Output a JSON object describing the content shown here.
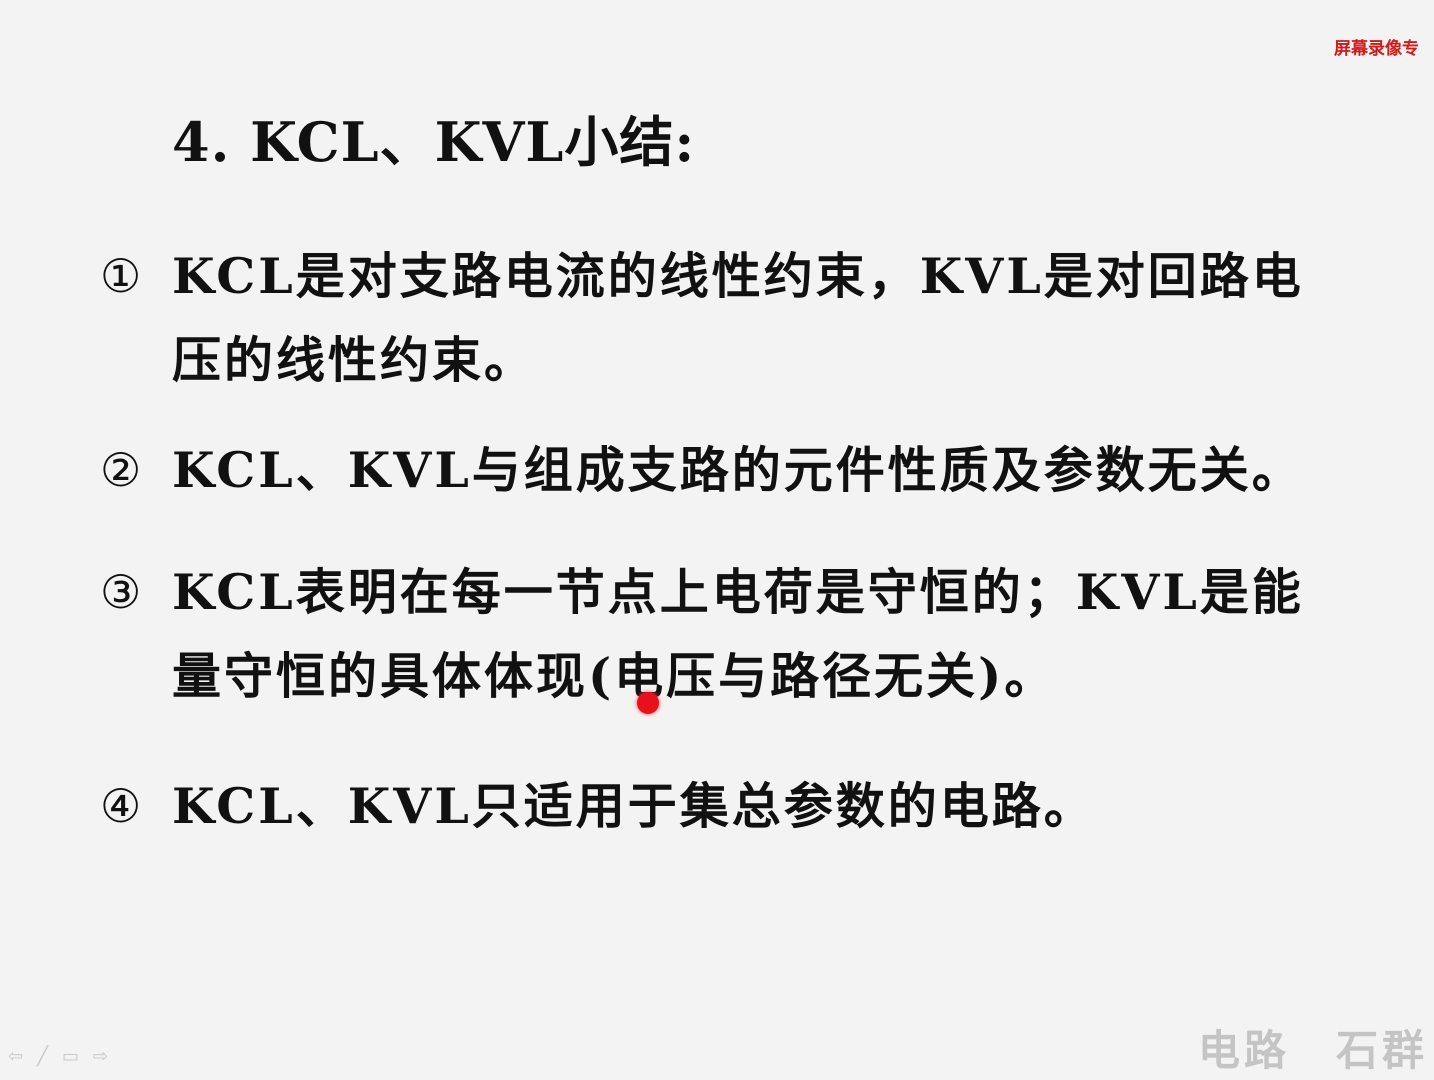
{
  "watermark": "屏幕录像专",
  "title": "4.  KCL、KVL小结:",
  "items": [
    {
      "num": "①",
      "text": "KCL是对支路电流的线性约束，KVL是对回路电压的线性约束。"
    },
    {
      "num": "②",
      "text": "KCL、KVL与组成支路的元件性质及参数无关。"
    },
    {
      "num": "③",
      "text": "KCL表明在每一节点上电荷是守恒的；KVL是能量守恒的具体体现(电压与路径无关)。"
    },
    {
      "num": "④",
      "text": "KCL、KVL只适用于集总参数的电路。"
    }
  ],
  "footer": {
    "course": "电路",
    "author": "石群"
  },
  "nav_icons": [
    "prev-arrow-icon",
    "pen-icon",
    "menu-icon",
    "next-arrow-icon"
  ],
  "nav_glyphs": {
    "prev": "⇦",
    "pen": "╱",
    "menu": "▭",
    "next": "⇨"
  },
  "colors": {
    "laser": "#e8101a",
    "watermark": "#d11a1a"
  }
}
